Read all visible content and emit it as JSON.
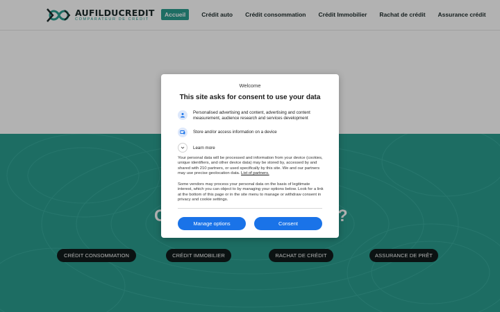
{
  "header": {
    "brand": "AUFILDUCREDIT",
    "tagline": "COMPARATEUR DE CRÉDIT",
    "nav": [
      {
        "label": "Accueil",
        "active": true
      },
      {
        "label": "Crédit auto"
      },
      {
        "label": "Crédit consommation"
      },
      {
        "label": "Crédit Immobilier"
      },
      {
        "label": "Rachat de crédit"
      },
      {
        "label": "Assurance crédit"
      }
    ],
    "accent_color": "#2a9d8f"
  },
  "hero": {
    "title_left_fragment": "C",
    "title_right_fragment": "?",
    "categories": [
      "CRÉDIT CONSOMMATION",
      "CRÉDIT IMMOBILIER",
      "RACHAT DE CRÉDIT",
      "ASSURANCE DE PRÊT"
    ]
  },
  "consent": {
    "welcome": "Welcome",
    "title": "This site asks for consent to use your data",
    "purposes": [
      {
        "icon": "person-icon",
        "text": "Personalised advertising and content, advertising and content measurement, audience research and services development"
      },
      {
        "icon": "device-icon",
        "text": "Store and/or access information on a device"
      }
    ],
    "learn_more": "Learn more",
    "paragraph1": "Your personal data will be processed and information from your device (cookies, unique identifiers, and other device data) may be stored by, accessed by and shared with 210 partners, or used specifically by this site. We and our partners may use precise geolocation data.",
    "partners_link": "List of partners.",
    "paragraph2": "Some vendors may process your personal data on the basis of legitimate interest, which you can object to by managing your options below. Look for a link at the bottom of this page or in the site menu to manage or withdraw consent in privacy and cookie settings.",
    "manage_button": "Manage options",
    "consent_button": "Consent",
    "button_color": "#1a73e8"
  }
}
